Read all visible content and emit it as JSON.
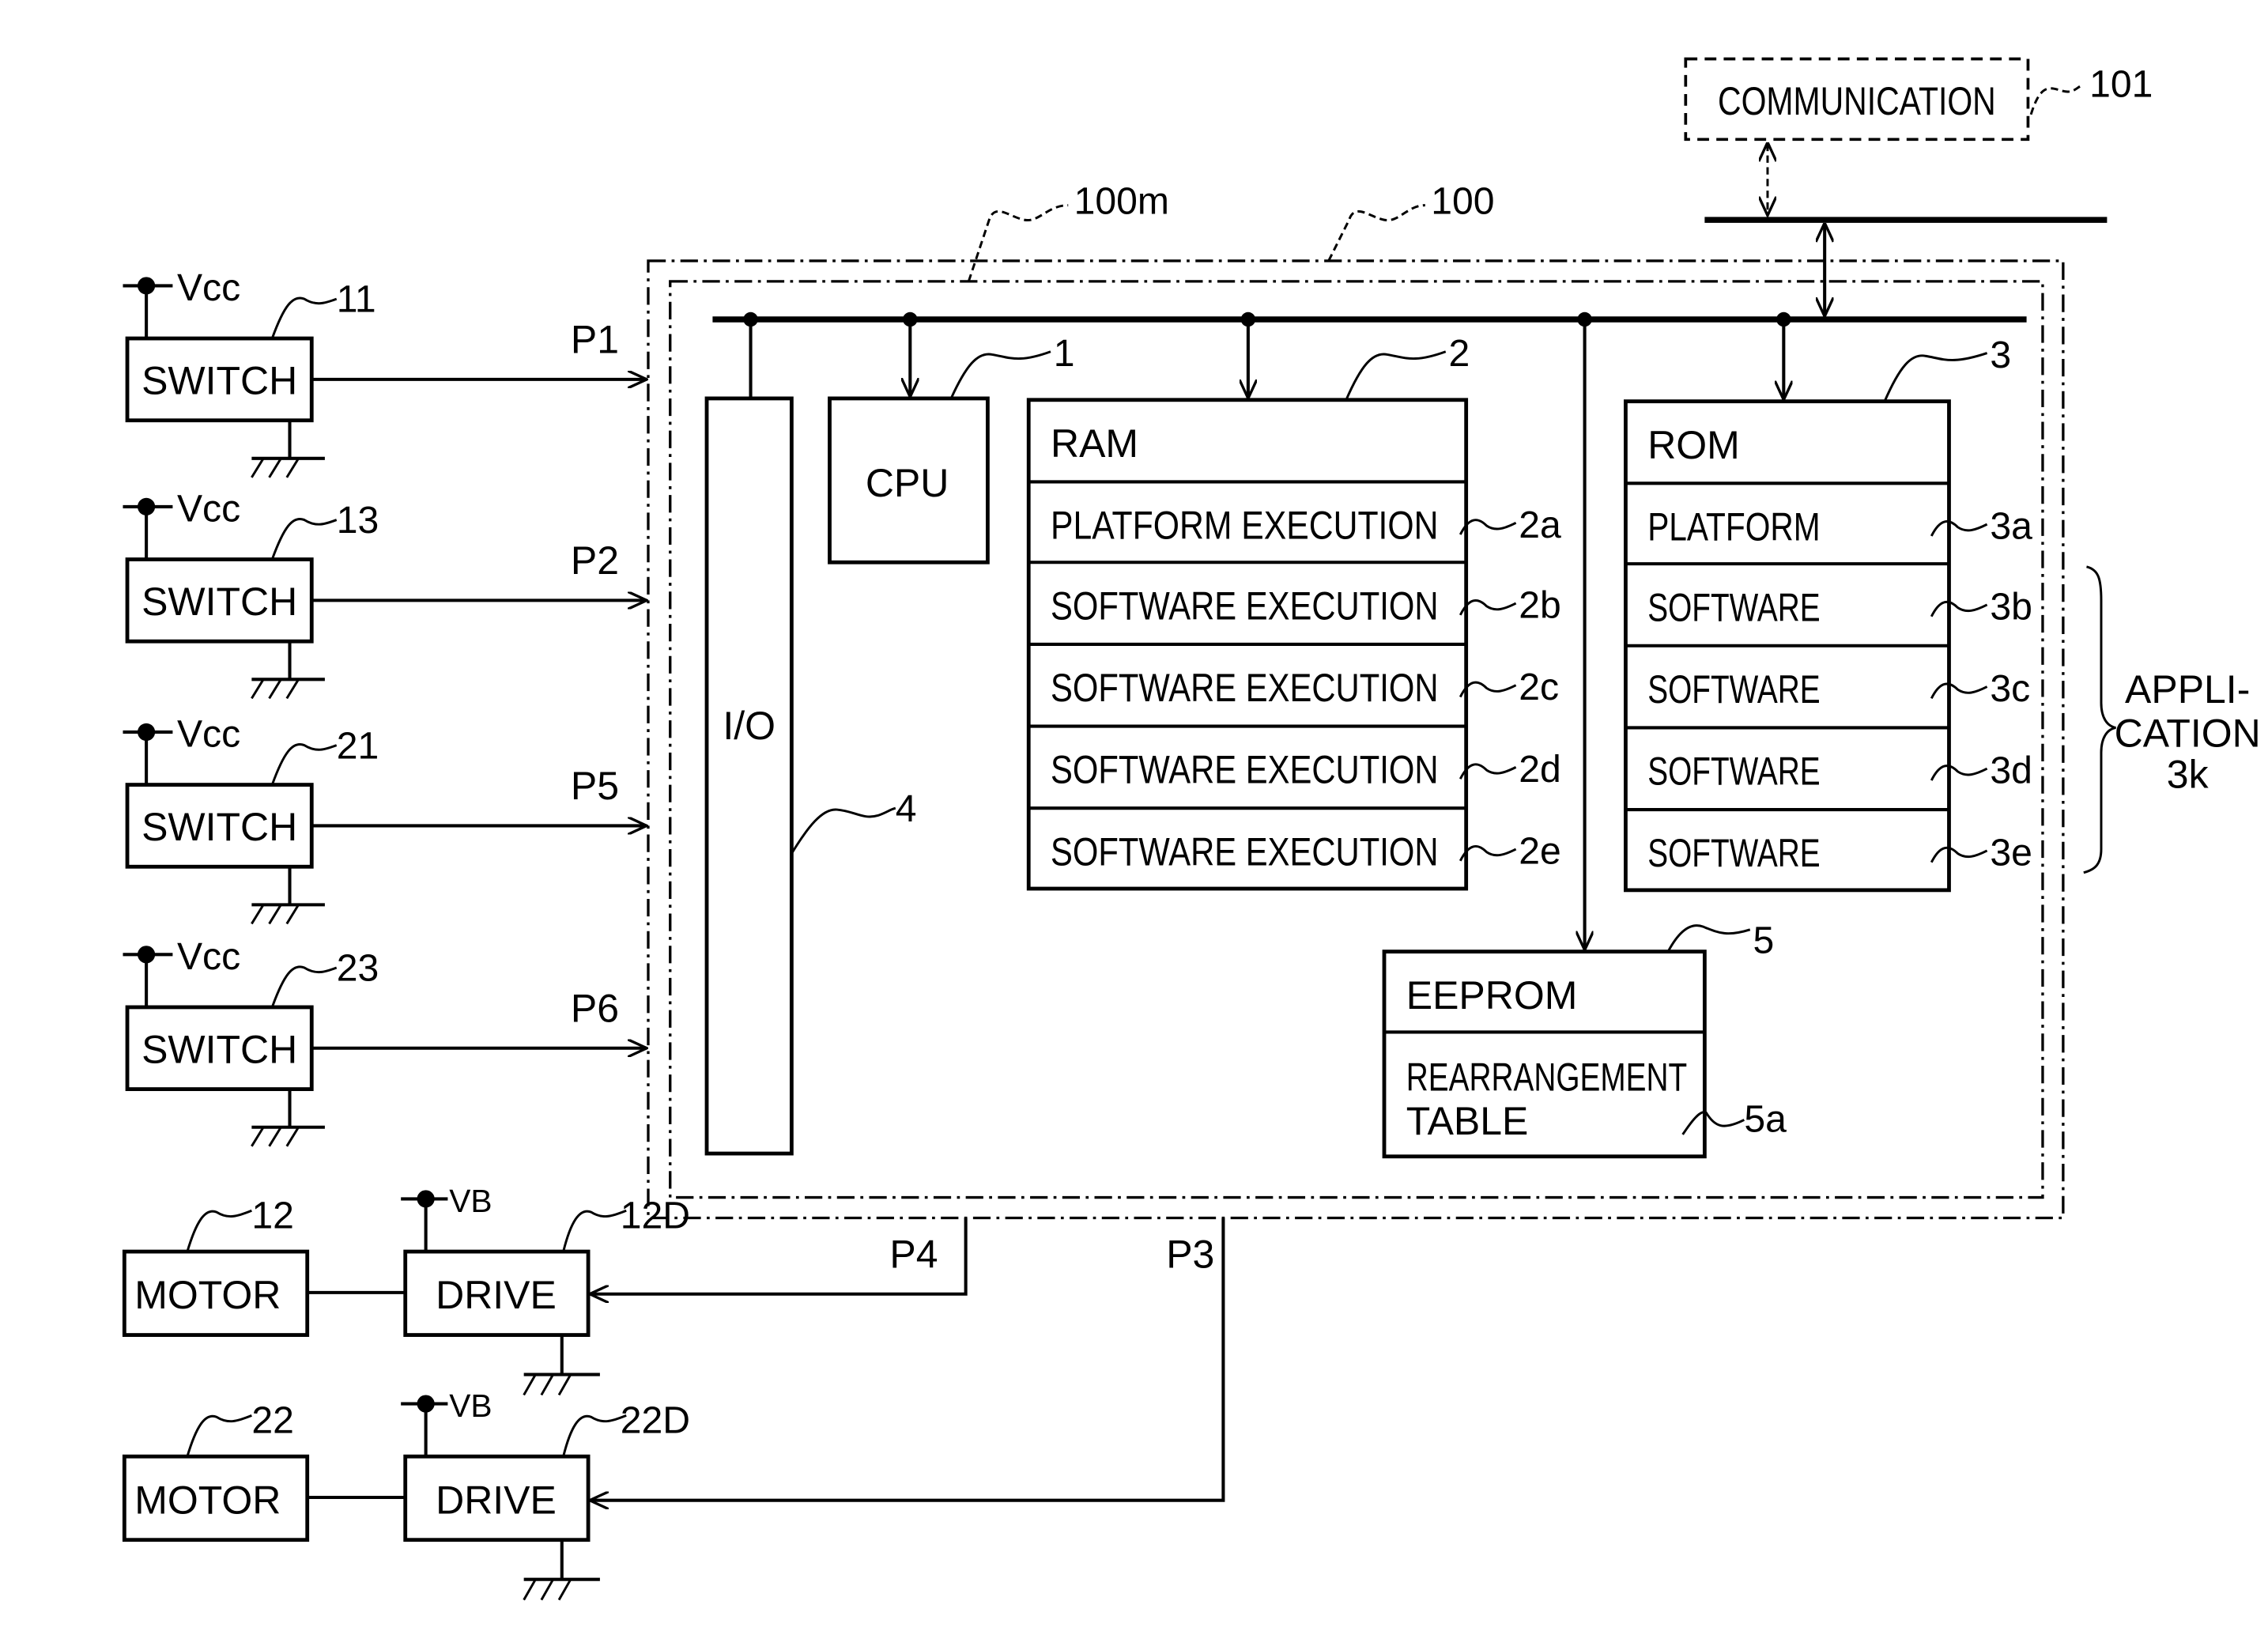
{
  "figure": {
    "communication": {
      "label": "COMMUNICATION",
      "ref": "101"
    },
    "ecu": {
      "ref": "100",
      "microcomputer_ref": "100m"
    },
    "cpu": {
      "label": "CPU",
      "ref": "1"
    },
    "io": {
      "label": "I/O",
      "ref": "4"
    },
    "ram": {
      "label": "RAM",
      "ref": "2",
      "rows": [
        {
          "label": "PLATFORM EXECUTION",
          "ref": "2a"
        },
        {
          "label": "SOFTWARE EXECUTION",
          "ref": "2b"
        },
        {
          "label": "SOFTWARE EXECUTION",
          "ref": "2c"
        },
        {
          "label": "SOFTWARE EXECUTION",
          "ref": "2d"
        },
        {
          "label": "SOFTWARE EXECUTION",
          "ref": "2e"
        }
      ]
    },
    "rom": {
      "label": "ROM",
      "ref": "3",
      "rows": [
        {
          "label": "PLATFORM",
          "ref": "3a"
        },
        {
          "label": "SOFTWARE",
          "ref": "3b"
        },
        {
          "label": "SOFTWARE",
          "ref": "3c"
        },
        {
          "label": "SOFTWARE",
          "ref": "3d"
        },
        {
          "label": "SOFTWARE",
          "ref": "3e"
        }
      ]
    },
    "application": {
      "line1": "APPLI-",
      "line2": "CATION",
      "line3": "3k"
    },
    "eeprom": {
      "label": "EEPROM",
      "ref": "5",
      "table_line1": "REARRANGEMENT",
      "table_line2": "TABLE",
      "table_ref": "5a"
    },
    "switches": [
      {
        "label": "SWITCH",
        "ref": "11",
        "supply": "Vcc",
        "port": "P1"
      },
      {
        "label": "SWITCH",
        "ref": "13",
        "supply": "Vcc",
        "port": "P2"
      },
      {
        "label": "SWITCH",
        "ref": "21",
        "supply": "Vcc",
        "port": "P5"
      },
      {
        "label": "SWITCH",
        "ref": "23",
        "supply": "Vcc",
        "port": "P6"
      }
    ],
    "motors": [
      {
        "label": "MOTOR",
        "ref": "12",
        "drive_label": "DRIVE",
        "drive_ref": "12D",
        "supply": "VB",
        "port": "P4"
      },
      {
        "label": "MOTOR",
        "ref": "22",
        "drive_label": "DRIVE",
        "drive_ref": "22D",
        "supply": "VB",
        "port": "P3"
      }
    ]
  }
}
